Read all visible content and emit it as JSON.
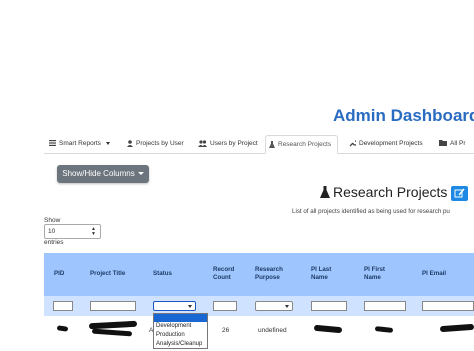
{
  "header": {
    "title": "Admin Dashboard"
  },
  "tabs": [
    {
      "label": "Smart Reports",
      "icon": "list-icon",
      "has_caret": true,
      "active": false
    },
    {
      "label": "Projects by User",
      "icon": "user-icon",
      "active": false
    },
    {
      "label": "Users by Project",
      "icon": "users-icon",
      "active": false
    },
    {
      "label": "Research Projects",
      "icon": "flask-icon",
      "active": true
    },
    {
      "label": "Development Projects",
      "icon": "wrench-icon",
      "active": false
    },
    {
      "label": "All Pr",
      "icon": "folder-icon",
      "active": false
    }
  ],
  "toolbar": {
    "show_hide_label": "Show/Hide Columns"
  },
  "section": {
    "title": "Research Projects",
    "title_icon": "flask-icon",
    "edit_icon": "edit-icon",
    "description": "List of all projects identified as being used for research pu"
  },
  "length": {
    "show_label": "Show",
    "selected": "10",
    "entries_label": "entries"
  },
  "table": {
    "columns": [
      {
        "key": "pid",
        "lines": [
          "PID"
        ]
      },
      {
        "key": "title",
        "lines": [
          "Project Title"
        ]
      },
      {
        "key": "status",
        "lines": [
          "Status"
        ]
      },
      {
        "key": "record_count",
        "lines": [
          "Record",
          "Count"
        ]
      },
      {
        "key": "purpose",
        "lines": [
          "Research",
          "Purpose"
        ]
      },
      {
        "key": "pi_last",
        "lines": [
          "PI Last",
          "Name"
        ]
      },
      {
        "key": "pi_first",
        "lines": [
          "PI First",
          "Name"
        ]
      },
      {
        "key": "pi_email",
        "lines": [
          "PI Email"
        ]
      }
    ],
    "rows": [
      {
        "status_partial": "A",
        "record_count": "26",
        "purpose": "undefined"
      }
    ]
  },
  "status_dropdown": {
    "options": [
      "",
      "Development",
      "Production",
      "Analysis/Cleanup"
    ],
    "highlighted_index": 0
  },
  "colors": {
    "accent": "#2a6cc2",
    "header_bg": "#9ec5fe",
    "filter_bg": "#cfe2ff",
    "button_bg": "#6c757d",
    "edit_button": "#1e88e5"
  }
}
